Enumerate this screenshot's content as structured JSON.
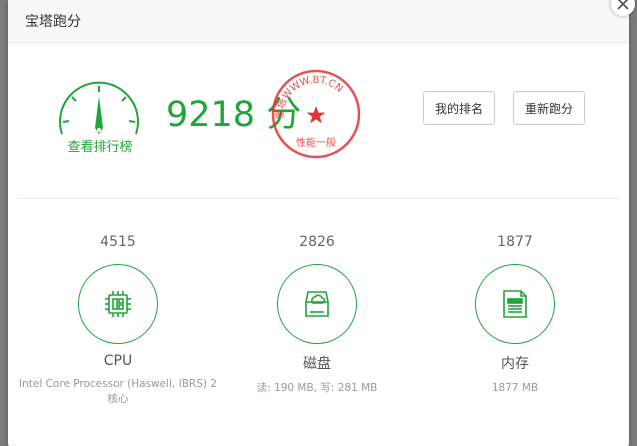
{
  "dialog": {
    "title": "宝塔跑分"
  },
  "gauge": {
    "label": "查看排行榜"
  },
  "score": {
    "value": "9218 分"
  },
  "seal": {
    "arc_text": "宝塔WWW.BT.CN",
    "bottom_text": "性能一般",
    "color": "#e53333"
  },
  "buttons": {
    "my_rank": "我的排名",
    "rerun": "重新跑分"
  },
  "metrics": [
    {
      "score": "4515",
      "name": "CPU",
      "desc": "Intel Core Processor (Haswell, IBRS) 2 核心",
      "icon": "cpu-chip-icon"
    },
    {
      "score": "2826",
      "name": "磁盘",
      "desc": "读: 190 MB,  写: 281 MB",
      "icon": "disk-drive-icon"
    },
    {
      "score": "1877",
      "name": "内存",
      "desc": "1877 MB",
      "icon": "memory-icon"
    }
  ],
  "colors": {
    "accent": "#20a53a",
    "seal": "#e53333"
  }
}
